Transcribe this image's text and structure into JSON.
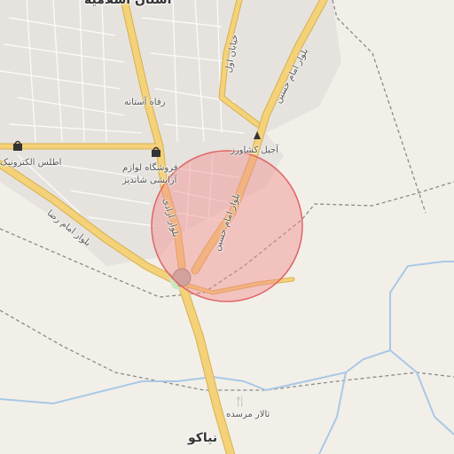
{
  "map": {
    "place_labels": {
      "top_town": "استان اسلامیه",
      "rafah_astaneh": "رفاه آستانه",
      "atlas_electronic": "اطلس الکترونیک",
      "cosmetics_store_line1": "فروشگاه لوازم",
      "cosmetics_store_line2": "آرایشی شاندیز",
      "ajil_keshavarz": "آجیل کشاورز",
      "talar_morsadeh": "تالار مرسده",
      "niakou": "نیاکو"
    },
    "road_labels": {
      "khayaban_aval": "خیابان اول",
      "bolvar_imam_hossein_north": "بلوار امام حسین",
      "bolvar_imam_reza": "بلوار امام رضا",
      "bolvar_azadi": "بلوار آزادی",
      "bolvar_imam_hossein_south": "بلوار امام حسین"
    },
    "highlight_circle": {
      "fill": "#f28b8b",
      "stroke": "#e06565"
    },
    "colors": {
      "background": "#f2efe9",
      "urban_area": "#e6e3df",
      "road_fill": "#f4d27a",
      "road_casing": "#d9b04a",
      "river": "#a9c8e6",
      "boundary": "#8a8a8a"
    },
    "icons": {
      "shop": "shopping-bag-icon",
      "shop_2": "shopping-bag-icon",
      "restaurant": "fork-knife-icon",
      "nut_shop": "nut-shop-icon"
    }
  }
}
